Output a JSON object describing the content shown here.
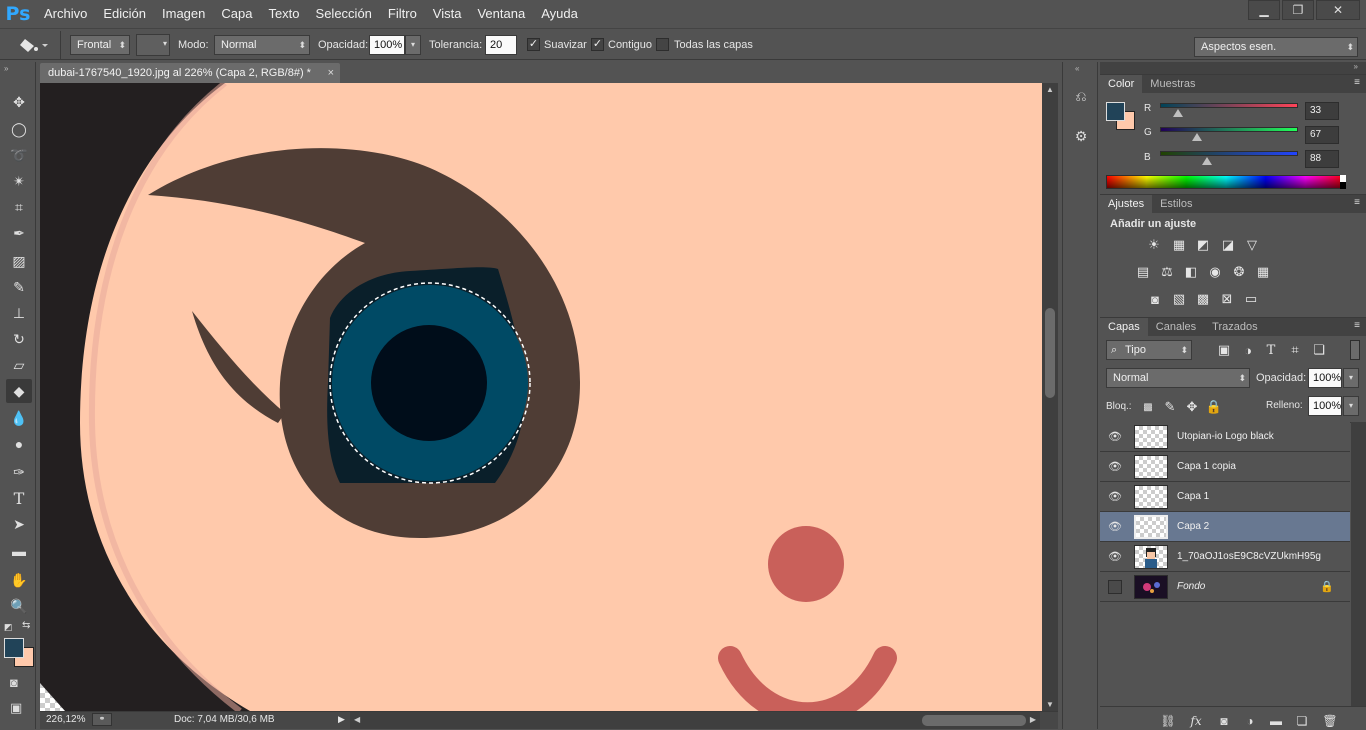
{
  "app": {
    "logo": "Ps"
  },
  "menu": [
    "Archivo",
    "Edición",
    "Imagen",
    "Capa",
    "Texto",
    "Selección",
    "Filtro",
    "Vista",
    "Ventana",
    "Ayuda"
  ],
  "options": {
    "fill_source": "Frontal",
    "mode_label": "Modo:",
    "mode_value": "Normal",
    "opacity_label": "Opacidad:",
    "opacity_value": "100%",
    "tolerance_label": "Tolerancia:",
    "tolerance_value": "20",
    "antialias_label": "Suavizar",
    "antialias_checked": true,
    "contiguous_label": "Contiguo",
    "contiguous_checked": true,
    "all_layers_label": "Todas las capas",
    "all_layers_checked": false,
    "workspace": "Aspectos esen."
  },
  "document": {
    "tab_title": "dubai-1767540_1920.jpg al 226% (Capa 2, RGB/8#) *",
    "zoom": "226,12%",
    "doc_info": "Doc: 7,04 MB/30,6 MB"
  },
  "colors": {
    "foreground": "#214358",
    "background": "#ffc9ab",
    "skin": "#ffc9ab",
    "brow": "#4f3d35",
    "iris": "#004a65",
    "pupil": "#000d1a",
    "mouth": "#c9605a"
  },
  "color_panel": {
    "tabs": [
      "Color",
      "Muestras"
    ],
    "r_label": "R",
    "r_value": "33",
    "g_label": "G",
    "g_value": "67",
    "b_label": "B",
    "b_value": "88"
  },
  "adjust_panel": {
    "tabs": [
      "Ajustes",
      "Estilos"
    ],
    "heading": "Añadir un ajuste"
  },
  "layers_panel": {
    "tabs": [
      "Capas",
      "Canales",
      "Trazados"
    ],
    "filter": "Tipo",
    "blend": "Normal",
    "opacity_label": "Opacidad:",
    "opacity_value": "100%",
    "lock_label": "Bloq.:",
    "fill_label": "Relleno:",
    "fill_value": "100%",
    "layers": [
      {
        "name": "Utopian-io Logo black",
        "visible": true,
        "selected": false
      },
      {
        "name": "Capa 1 copia",
        "visible": true,
        "selected": false
      },
      {
        "name": "Capa 1",
        "visible": true,
        "selected": false
      },
      {
        "name": "Capa 2",
        "visible": true,
        "selected": true
      },
      {
        "name": "1_70aOJ1osE9C8cVZUkmH95g",
        "visible": true,
        "selected": false
      },
      {
        "name": "Fondo",
        "visible": false,
        "selected": false
      }
    ]
  }
}
